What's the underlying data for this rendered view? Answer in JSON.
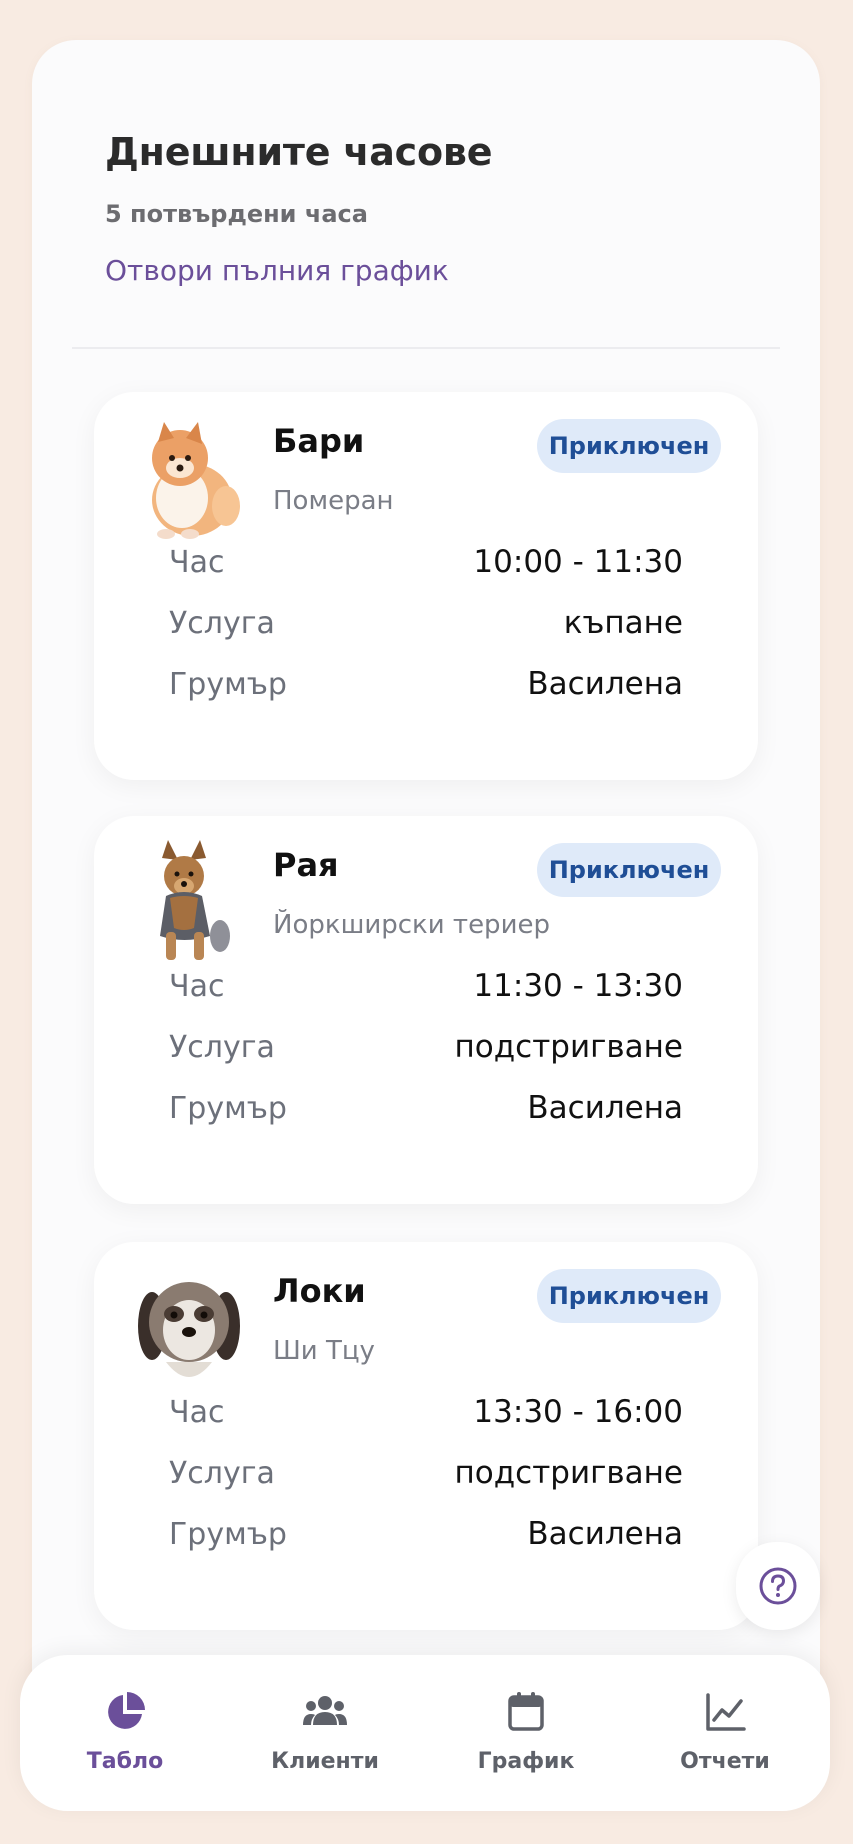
{
  "header": {
    "title": "Днешните часове",
    "subtitle": "5 потвърдени часа",
    "schedule_link": "Отвори пълния график"
  },
  "appointments": [
    {
      "pet_name": "Бари",
      "breed": "Померан",
      "status": "Приключен",
      "time_label": "Час",
      "time": "10:00 - 11:30",
      "service_label": "Услуга",
      "service": "къпане",
      "groomer_label": "Грумър",
      "groomer": "Василена",
      "photo": "pomeranian-dog-photo"
    },
    {
      "pet_name": "Рая",
      "breed": "Йоркширски териер",
      "status": "Приключен",
      "time_label": "Час",
      "time": "11:30 - 13:30",
      "service_label": "Услуга",
      "service": "подстригване",
      "groomer_label": "Грумър",
      "groomer": "Василена",
      "photo": "yorkshire-terrier-dog-photo"
    },
    {
      "pet_name": "Локи",
      "breed": "Ши Тцу",
      "status": "Приключен",
      "time_label": "Час",
      "time": "13:30 - 16:00",
      "service_label": "Услуга",
      "service": "подстригване",
      "groomer_label": "Грумър",
      "groomer": "Василена",
      "photo": "shih-tzu-dog-photo"
    }
  ],
  "help_icon": "help-circle-icon",
  "nav": {
    "items": [
      {
        "label": "Табло",
        "icon": "pie-chart-icon",
        "active": true
      },
      {
        "label": "Клиенти",
        "icon": "users-icon",
        "active": false
      },
      {
        "label": "График",
        "icon": "calendar-icon",
        "active": false
      },
      {
        "label": "Отчети",
        "icon": "line-chart-icon",
        "active": false
      }
    ]
  },
  "colors": {
    "background": "#f8ebe2",
    "accent": "#6b4f9a",
    "badge_bg": "#dfeaf9",
    "badge_text": "#1f4e96"
  }
}
